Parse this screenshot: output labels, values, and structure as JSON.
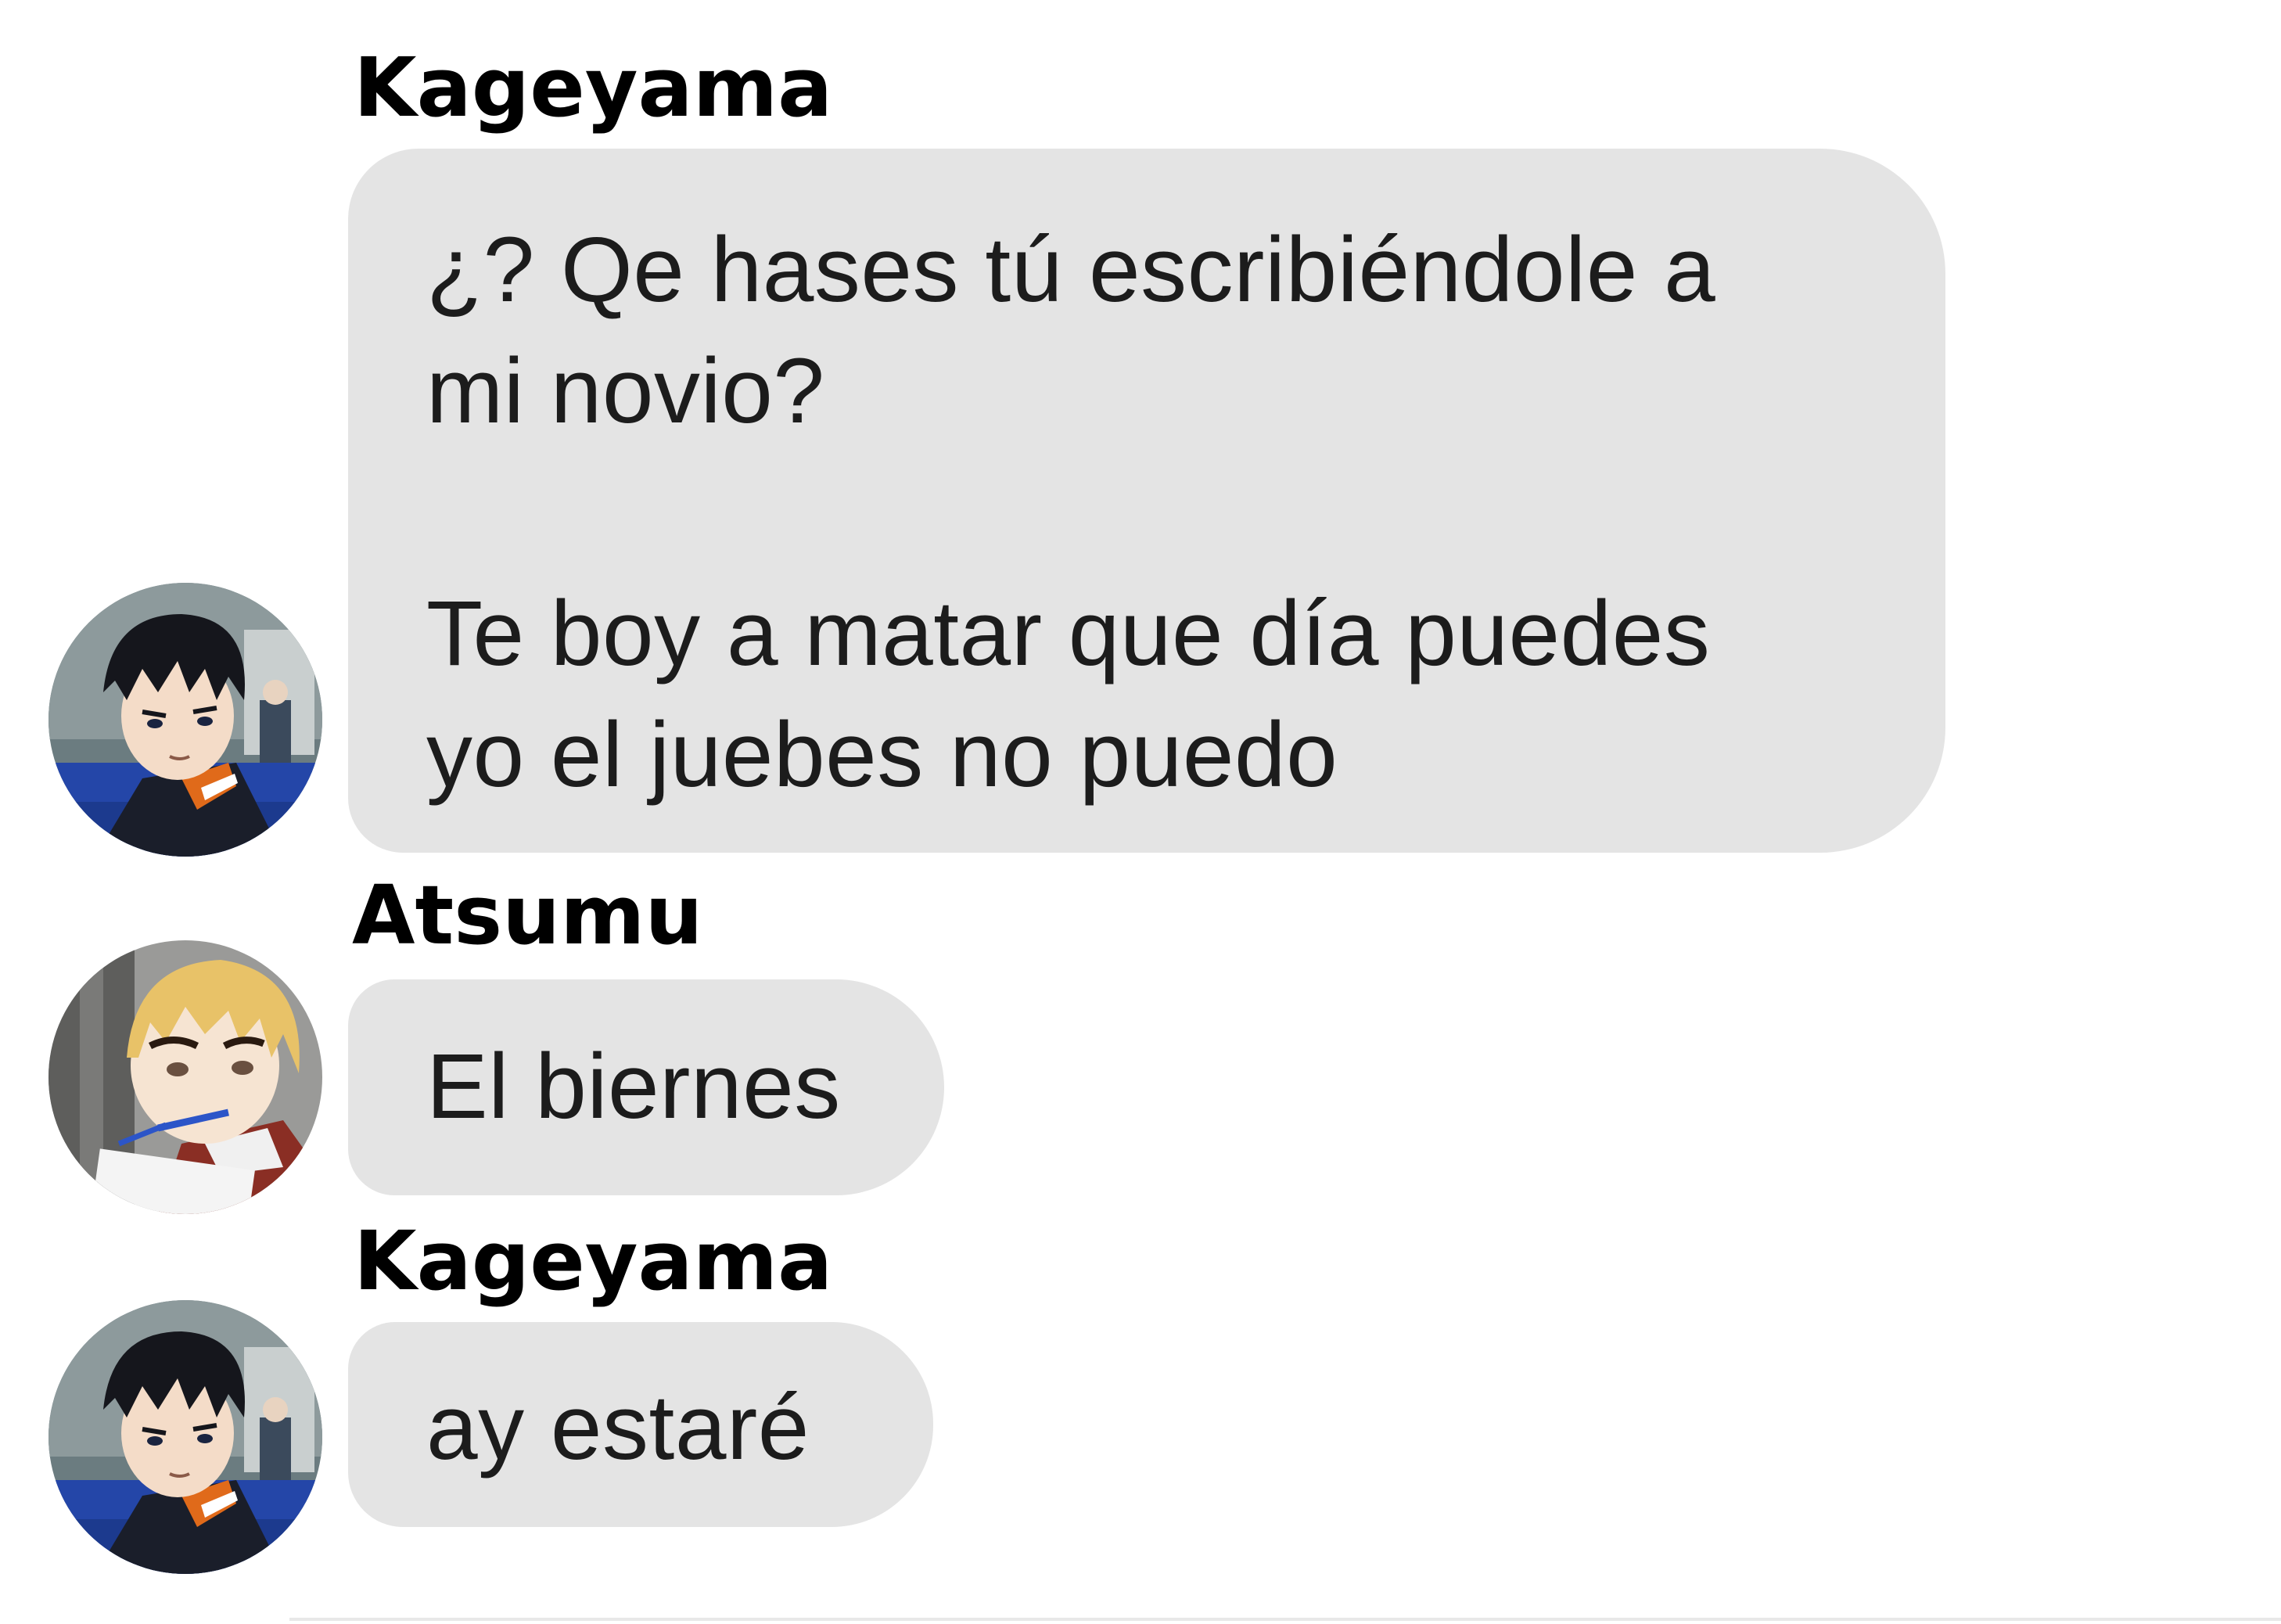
{
  "messages": [
    {
      "sender": "Kageyama",
      "avatar_icon": "kageyama-avatar-icon",
      "text": "¿? Qe hases tú escribiéndole a\nmi novio?\n\nTe boy a matar que día puedes\nyo el juebes no puedo"
    },
    {
      "sender": "Atsumu",
      "avatar_icon": "atsumu-avatar-icon",
      "text": "El biernes"
    },
    {
      "sender": "Kageyama",
      "avatar_icon": "kageyama-avatar-icon",
      "text": "ay estaré"
    }
  ],
  "colors": {
    "bubble": "#e4e4e4",
    "text": "#1c1c1c",
    "name": "#000000",
    "background": "#ffffff"
  }
}
